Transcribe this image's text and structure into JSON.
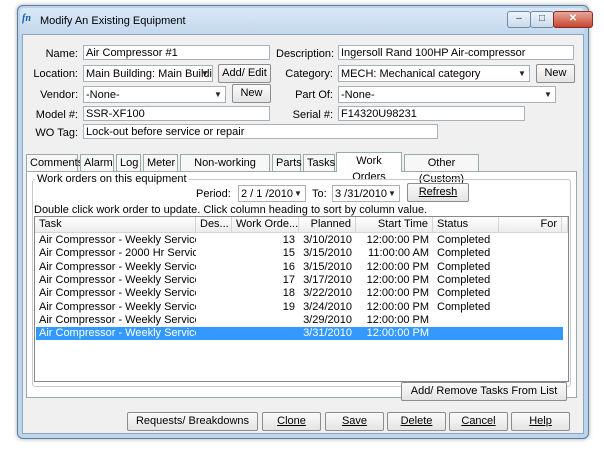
{
  "window": {
    "title": "Modify An Existing Equipment",
    "logo": "fn"
  },
  "form": {
    "name_label": "Name:",
    "name_value": "Air Compressor #1",
    "description_label": "Description:",
    "description_value": "Ingersoll Rand 100HP Air-compressor",
    "location_label": "Location:",
    "location_value": "Main Building: Main Buildi",
    "add_edit_label": "Add/ Edit",
    "category_label": "Category:",
    "category_value": "MECH: Mechanical category",
    "new_category_label": "New",
    "vendor_label": "Vendor:",
    "vendor_value": "-None-",
    "new_vendor_label": "New",
    "partof_label": "Part Of:",
    "partof_value": "-None-",
    "model_label": "Model #:",
    "model_value": "SSR-XF100",
    "serial_label": "Serial #:",
    "serial_value": "F14320U98231",
    "wotag_label": "WO Tag:",
    "wotag_value": "Lock-out before service or repair"
  },
  "tabs": [
    "Comments",
    "Alarm",
    "Log",
    "Meter",
    "Non-working Days",
    "Parts",
    "Tasks",
    "Work Orders",
    "Other (Custom)"
  ],
  "active_tab": "Work Orders",
  "workorders": {
    "group_title": "Work orders on this equipment",
    "period_label": "Period:",
    "period_from": "2 / 1 /2010",
    "to_label": "To:",
    "period_to": "3 /31/2010",
    "refresh_label": "Refresh",
    "instructions": "Double click work order to update. Click column heading to sort by column value.",
    "columns": [
      "Task",
      "Des...",
      "Work Orde...",
      "Planned",
      "Start Time",
      "Status",
      "For"
    ],
    "rows": [
      {
        "task": "Air Compressor - Weekly Service",
        "des": "",
        "wo": "13",
        "planned": "3/10/2010",
        "start": "12:00:00 PM",
        "status": "Completed",
        "for": ""
      },
      {
        "task": "Air Compressor - 2000 Hr Service",
        "des": "",
        "wo": "15",
        "planned": "3/15/2010",
        "start": "11:00:00 AM",
        "status": "Completed",
        "for": ""
      },
      {
        "task": "Air Compressor - Weekly Service",
        "des": "",
        "wo": "16",
        "planned": "3/15/2010",
        "start": "12:00:00 PM",
        "status": "Completed",
        "for": ""
      },
      {
        "task": "Air Compressor - Weekly Service",
        "des": "",
        "wo": "17",
        "planned": "3/17/2010",
        "start": "12:00:00 PM",
        "status": "Completed",
        "for": ""
      },
      {
        "task": "Air Compressor - Weekly Service",
        "des": "",
        "wo": "18",
        "planned": "3/22/2010",
        "start": "12:00:00 PM",
        "status": "Completed",
        "for": ""
      },
      {
        "task": "Air Compressor - Weekly Service",
        "des": "",
        "wo": "19",
        "planned": "3/24/2010",
        "start": "12:00:00 PM",
        "status": "Completed",
        "for": ""
      },
      {
        "task": "Air Compressor - Weekly Service",
        "des": "",
        "wo": "",
        "planned": "3/29/2010",
        "start": "12:00:00 PM",
        "status": "",
        "for": ""
      },
      {
        "task": "Air Compressor - Weekly Service",
        "des": "",
        "wo": "",
        "planned": "3/31/2010",
        "start": "12:00:00 PM",
        "status": "",
        "for": ""
      }
    ],
    "selected_row": 7,
    "add_remove_label": "Add/ Remove Tasks From List"
  },
  "bottom_buttons": {
    "requests": "Requests/ Breakdowns",
    "clone": "Clone",
    "save": "Save",
    "delete": "Delete",
    "cancel": "Cancel",
    "help": "Help"
  },
  "colors": {
    "selection": "#3399ff",
    "window_frame": "#bcd5ec"
  },
  "icons": {
    "dropdown": "chevron-down-icon",
    "minimize": "minimize-icon",
    "maximize": "maximize-icon",
    "close": "close-icon"
  }
}
